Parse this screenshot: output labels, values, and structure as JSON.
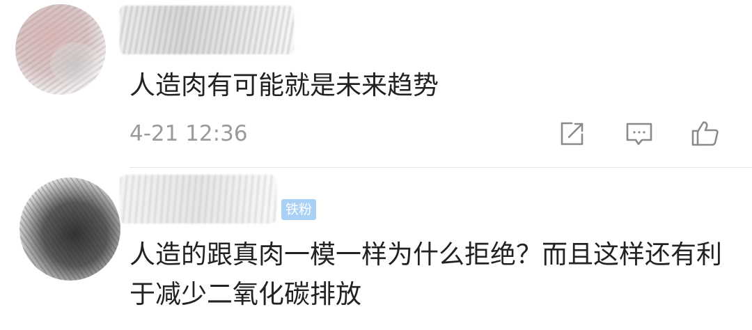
{
  "comments": [
    {
      "content": "人造肉有可能就是未来趋势",
      "time": "4-21 12:36"
    },
    {
      "badge": "铁粉",
      "content": "人造的跟真肉一模一样为什么拒绝？而且这样还有利于减少二氧化碳排放"
    }
  ],
  "actions": {
    "share_icon": "share-icon",
    "reply_icon": "comment-icon",
    "like_icon": "thumbs-up-icon"
  },
  "colors": {
    "text": "#222222",
    "muted": "#9a9a9a",
    "icon": "#8a8a8a",
    "badge_bg": "#a9d1f5"
  }
}
